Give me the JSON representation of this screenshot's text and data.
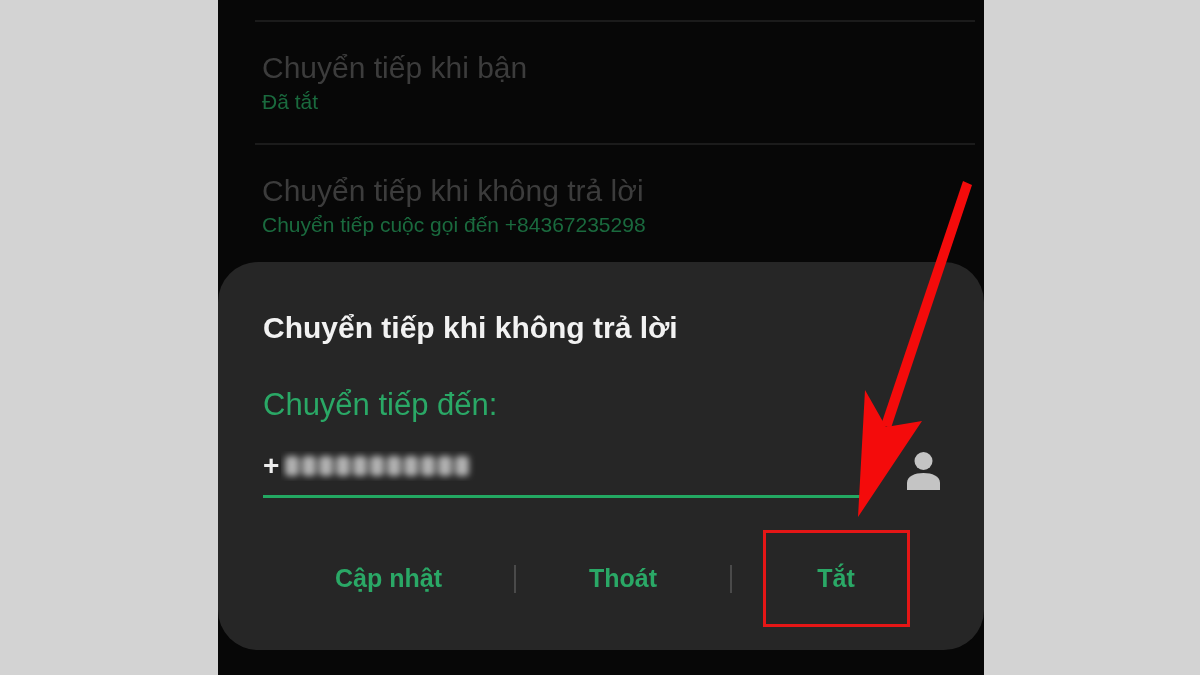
{
  "settings_list": [
    {
      "title": "Chuyển tiếp khi bận",
      "status": "Đã tắt"
    },
    {
      "title": "Chuyển tiếp khi không trả lời",
      "status": "Chuyển tiếp cuộc gọi đến +84367235298"
    }
  ],
  "dialog": {
    "title": "Chuyển tiếp khi không trả lời",
    "field_label": "Chuyển tiếp đến:",
    "field_value": "+",
    "field_redacted": true,
    "buttons": [
      {
        "label": "Cập nhật",
        "highlighted": false
      },
      {
        "label": "Thoát",
        "highlighted": false
      },
      {
        "label": "Tắt",
        "highlighted": true
      }
    ]
  }
}
